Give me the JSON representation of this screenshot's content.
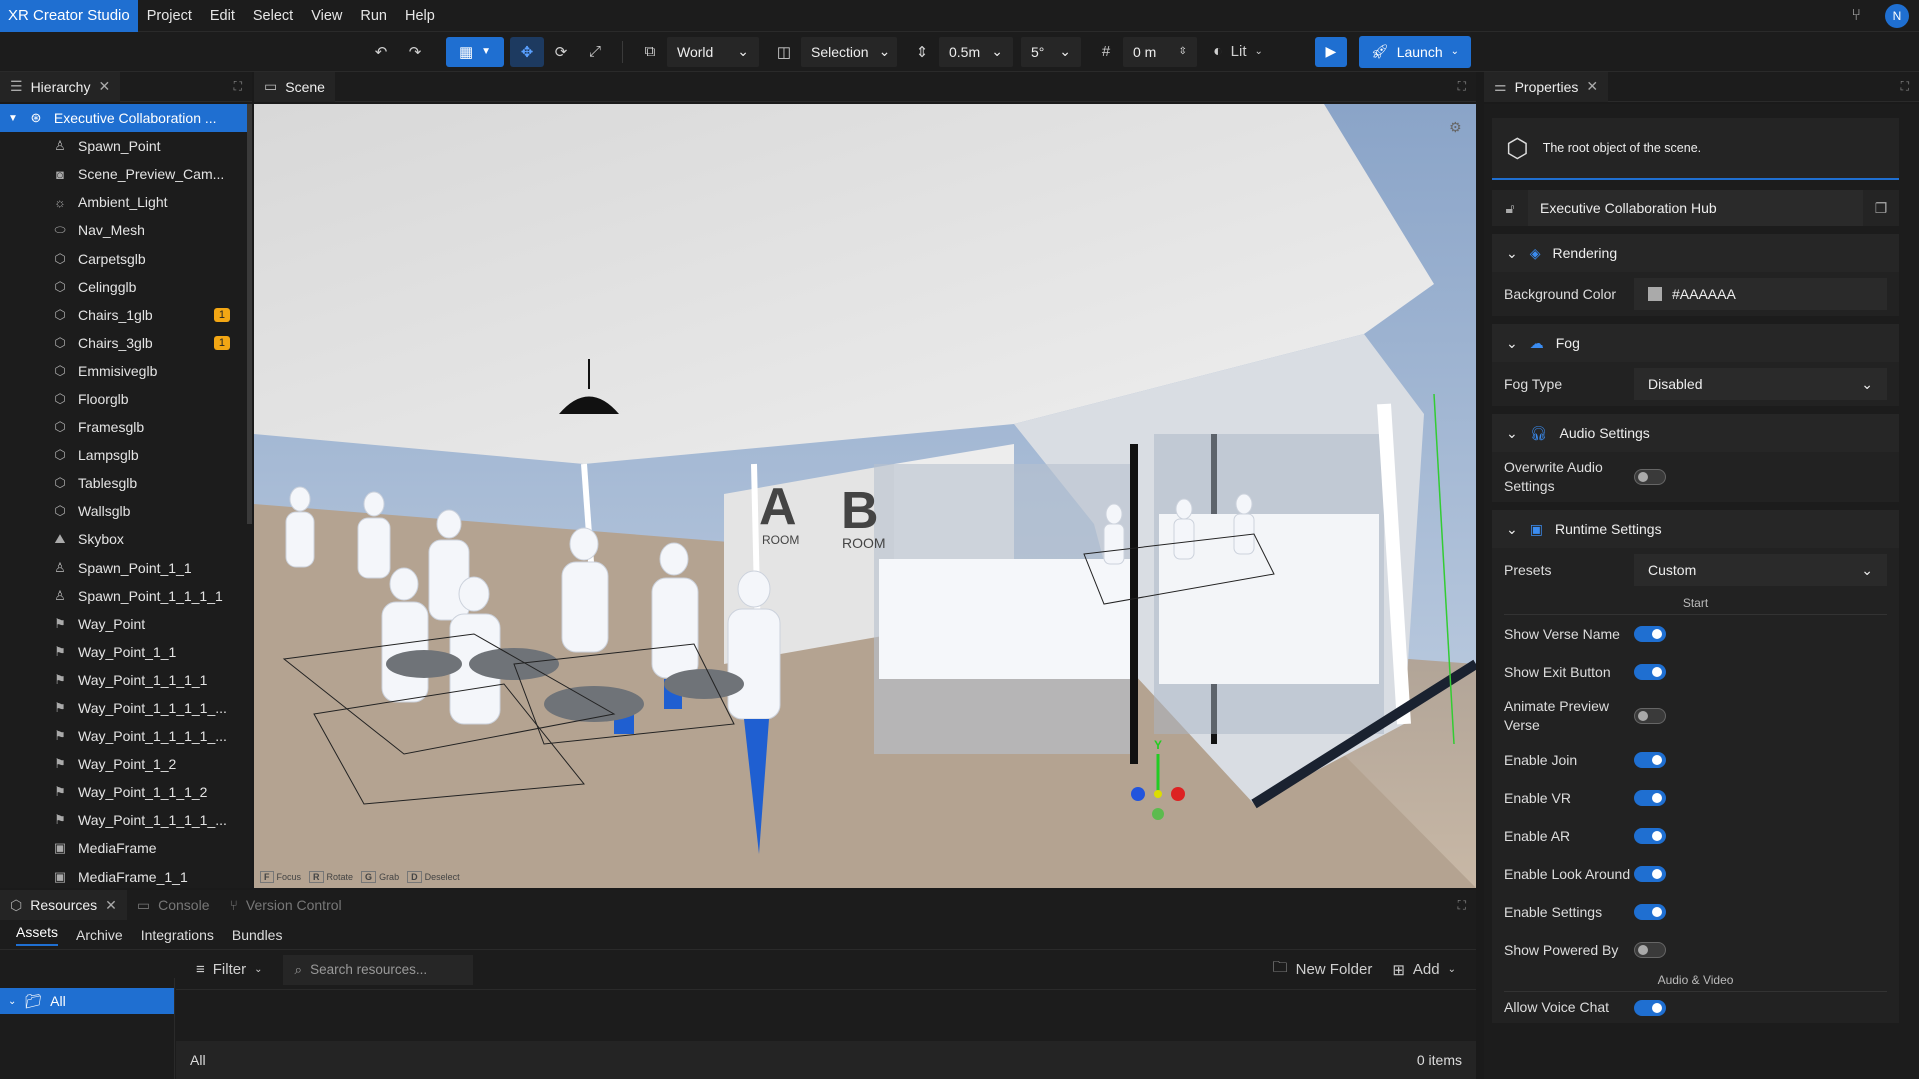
{
  "menubar": {
    "brand": "XR Creator Studio",
    "items": [
      "Project",
      "Edit",
      "Select",
      "View",
      "Run",
      "Help"
    ],
    "avatar": "N"
  },
  "toolbar": {
    "space": "World",
    "pivot": "Selection",
    "snap_distance": "0.5m",
    "snap_angle": "5°",
    "grid": "0 m",
    "lighting": "Lit",
    "launch": "Launch"
  },
  "hierarchy": {
    "title": "Hierarchy",
    "root": "Executive Collaboration ...",
    "items": [
      {
        "label": "Spawn_Point",
        "icon": "spawn-icon"
      },
      {
        "label": "Scene_Preview_Cam...",
        "icon": "camera-icon"
      },
      {
        "label": "Ambient_Light",
        "icon": "light-icon"
      },
      {
        "label": "Nav_Mesh",
        "icon": "navmesh-icon"
      },
      {
        "label": "Carpetsglb",
        "icon": "model-icon"
      },
      {
        "label": "Celingglb",
        "icon": "model-icon"
      },
      {
        "label": "Chairs_1glb",
        "icon": "model-icon",
        "warn": "1"
      },
      {
        "label": "Chairs_3glb",
        "icon": "model-icon",
        "warn": "1"
      },
      {
        "label": "Emmisiveglb",
        "icon": "model-icon"
      },
      {
        "label": "Floorglb",
        "icon": "model-icon"
      },
      {
        "label": "Framesglb",
        "icon": "model-icon"
      },
      {
        "label": "Lampsglb",
        "icon": "model-icon"
      },
      {
        "label": "Tablesglb",
        "icon": "model-icon"
      },
      {
        "label": "Wallsglb",
        "icon": "model-icon"
      },
      {
        "label": "Skybox",
        "icon": "skybox-icon"
      },
      {
        "label": "Spawn_Point_1_1",
        "icon": "spawn-icon"
      },
      {
        "label": "Spawn_Point_1_1_1_1",
        "icon": "spawn-icon"
      },
      {
        "label": "Way_Point",
        "icon": "waypoint-icon"
      },
      {
        "label": "Way_Point_1_1",
        "icon": "waypoint-icon"
      },
      {
        "label": "Way_Point_1_1_1_1",
        "icon": "waypoint-icon"
      },
      {
        "label": "Way_Point_1_1_1_1_...",
        "icon": "waypoint-icon"
      },
      {
        "label": "Way_Point_1_1_1_1_...",
        "icon": "waypoint-icon"
      },
      {
        "label": "Way_Point_1_2",
        "icon": "waypoint-icon"
      },
      {
        "label": "Way_Point_1_1_1_2",
        "icon": "waypoint-icon"
      },
      {
        "label": "Way_Point_1_1_1_1_...",
        "icon": "waypoint-icon"
      },
      {
        "label": "MediaFrame",
        "icon": "media-icon"
      },
      {
        "label": "MediaFrame_1_1",
        "icon": "media-icon"
      }
    ]
  },
  "scene": {
    "title": "Scene",
    "room_a": "A",
    "room_b": "B",
    "room_word": "ROOM",
    "axis_y": "Y",
    "hints": [
      {
        "key": "F",
        "label": "Focus"
      },
      {
        "key": "R",
        "label": "Rotate"
      },
      {
        "key": "G",
        "label": "Grab"
      },
      {
        "key": "D",
        "label": "Deselect"
      }
    ]
  },
  "properties": {
    "title": "Properties",
    "info": "The root object of the scene.",
    "name": "Executive Collaboration Hub",
    "rendering": {
      "title": "Rendering",
      "bg_label": "Background Color",
      "bg_value": "#AAAAAA"
    },
    "fog": {
      "title": "Fog",
      "type_label": "Fog Type",
      "type_value": "Disabled"
    },
    "audio": {
      "title": "Audio Settings",
      "overwrite_label": "Overwrite Audio Settings",
      "overwrite_on": false
    },
    "runtime": {
      "title": "Runtime Settings",
      "presets_label": "Presets",
      "presets_value": "Custom",
      "start_header": "Start",
      "toggles": [
        {
          "label": "Show Verse Name",
          "on": true
        },
        {
          "label": "Show Exit Button",
          "on": true
        },
        {
          "label": "Animate Preview Verse",
          "on": false
        },
        {
          "label": "Enable Join",
          "on": true
        },
        {
          "label": "Enable VR",
          "on": true
        },
        {
          "label": "Enable AR",
          "on": true
        },
        {
          "label": "Enable Look Around",
          "on": true
        },
        {
          "label": "Enable Settings",
          "on": true
        },
        {
          "label": "Show Powered By",
          "on": false
        }
      ],
      "av_header": "Audio & Video",
      "voice_label": "Allow Voice Chat",
      "voice_on": true
    }
  },
  "resources": {
    "tabs": [
      "Resources",
      "Console",
      "Version Control"
    ],
    "subtabs": [
      "Assets",
      "Archive",
      "Integrations",
      "Bundles"
    ],
    "folder": "All",
    "filter": "Filter",
    "search_placeholder": "Search resources...",
    "new_folder": "New Folder",
    "add": "Add",
    "footer_left": "All",
    "footer_right": "0 items"
  },
  "colors": {
    "accent": "#1f6fd1",
    "warning": "#f2a614"
  }
}
